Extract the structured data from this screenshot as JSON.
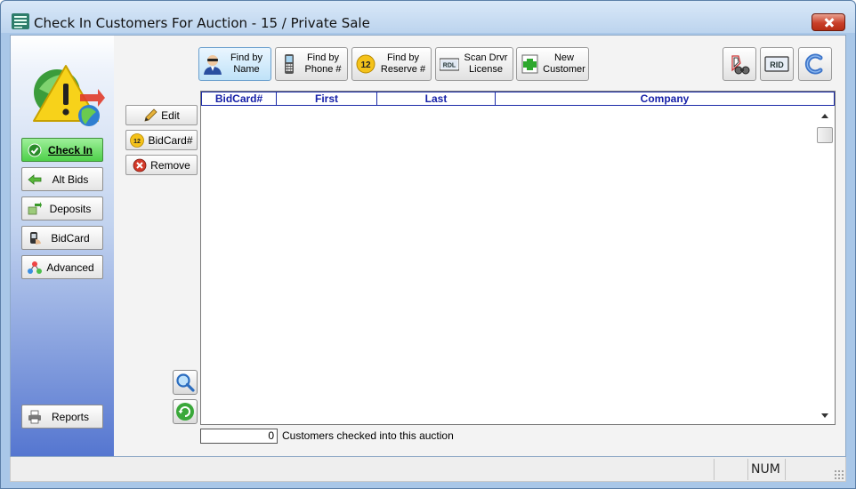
{
  "window": {
    "title": "Check In Customers For Auction  -  15 / Private Sale"
  },
  "sidebar": {
    "items": [
      {
        "label": "Check In",
        "icon": "check-circle-icon",
        "active": true
      },
      {
        "label": "Alt Bids",
        "icon": "arrow-left-icon",
        "active": false
      },
      {
        "label": "Deposits",
        "icon": "money-arrow-icon",
        "active": false
      },
      {
        "label": "BidCard",
        "icon": "phone-hand-icon",
        "active": false
      },
      {
        "label": "Advanced",
        "icon": "network-icon",
        "active": false
      }
    ],
    "reports_label": "Reports"
  },
  "toolbar": {
    "find_by_name": "Find by\nName",
    "find_by_phone": "Find by\nPhone #",
    "find_by_reserve": "Find by\nReserve #",
    "scan_license": "Scan Drvr\nLicense",
    "new_customer": "New\nCustomer",
    "reserve_badge": "12",
    "scan_badge": "RDL",
    "id_badge": "RID"
  },
  "actions": {
    "edit": "Edit",
    "bidcard": "BidCard#",
    "bidcard_badge": "12",
    "remove": "Remove"
  },
  "grid": {
    "columns": [
      "BidCard#",
      "First",
      "Last",
      "Company"
    ],
    "rows": []
  },
  "footer": {
    "count": "0",
    "count_label": "Customers checked into this auction"
  },
  "statusbar": {
    "num": "NUM"
  },
  "colors": {
    "header_text": "#1620a8",
    "active_green": "#4ed04a",
    "sidebar_blue": "#5576d0"
  }
}
